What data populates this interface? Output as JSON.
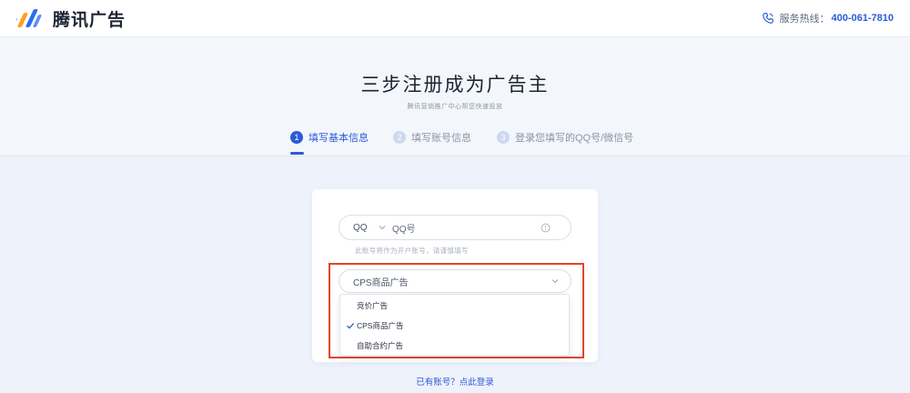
{
  "header": {
    "brand": "腾讯广告",
    "hotline_label": "服务热线：",
    "hotline_number": "400-061-7810",
    "colors": {
      "brand_blue": "#2b5bd7",
      "logo_orange": "#ff9f1c",
      "logo_blue": "#2b6cf0"
    }
  },
  "hero": {
    "title": "三步注册成为广告主",
    "subtitle": "腾讯营销推广中心帮您快速投放",
    "steps": [
      {
        "number": "1",
        "label": "填写基本信息",
        "active": true
      },
      {
        "number": "2",
        "label": "填写账号信息",
        "active": false
      },
      {
        "number": "3",
        "label": "登录您填写的QQ号/微信号",
        "active": false
      }
    ]
  },
  "form": {
    "account_type": "QQ",
    "account_placeholder": "QQ号",
    "hint": "此账号将作为开户账号，请谨慎填写",
    "ad_type_selected": "CPS商品广告",
    "ad_type_options": [
      {
        "label": "竞价广告",
        "selected": false
      },
      {
        "label": "CPS商品广告",
        "selected": true
      },
      {
        "label": "自助合约广告",
        "selected": false
      }
    ]
  },
  "footer": {
    "login_link": "已有账号？点此登录"
  }
}
